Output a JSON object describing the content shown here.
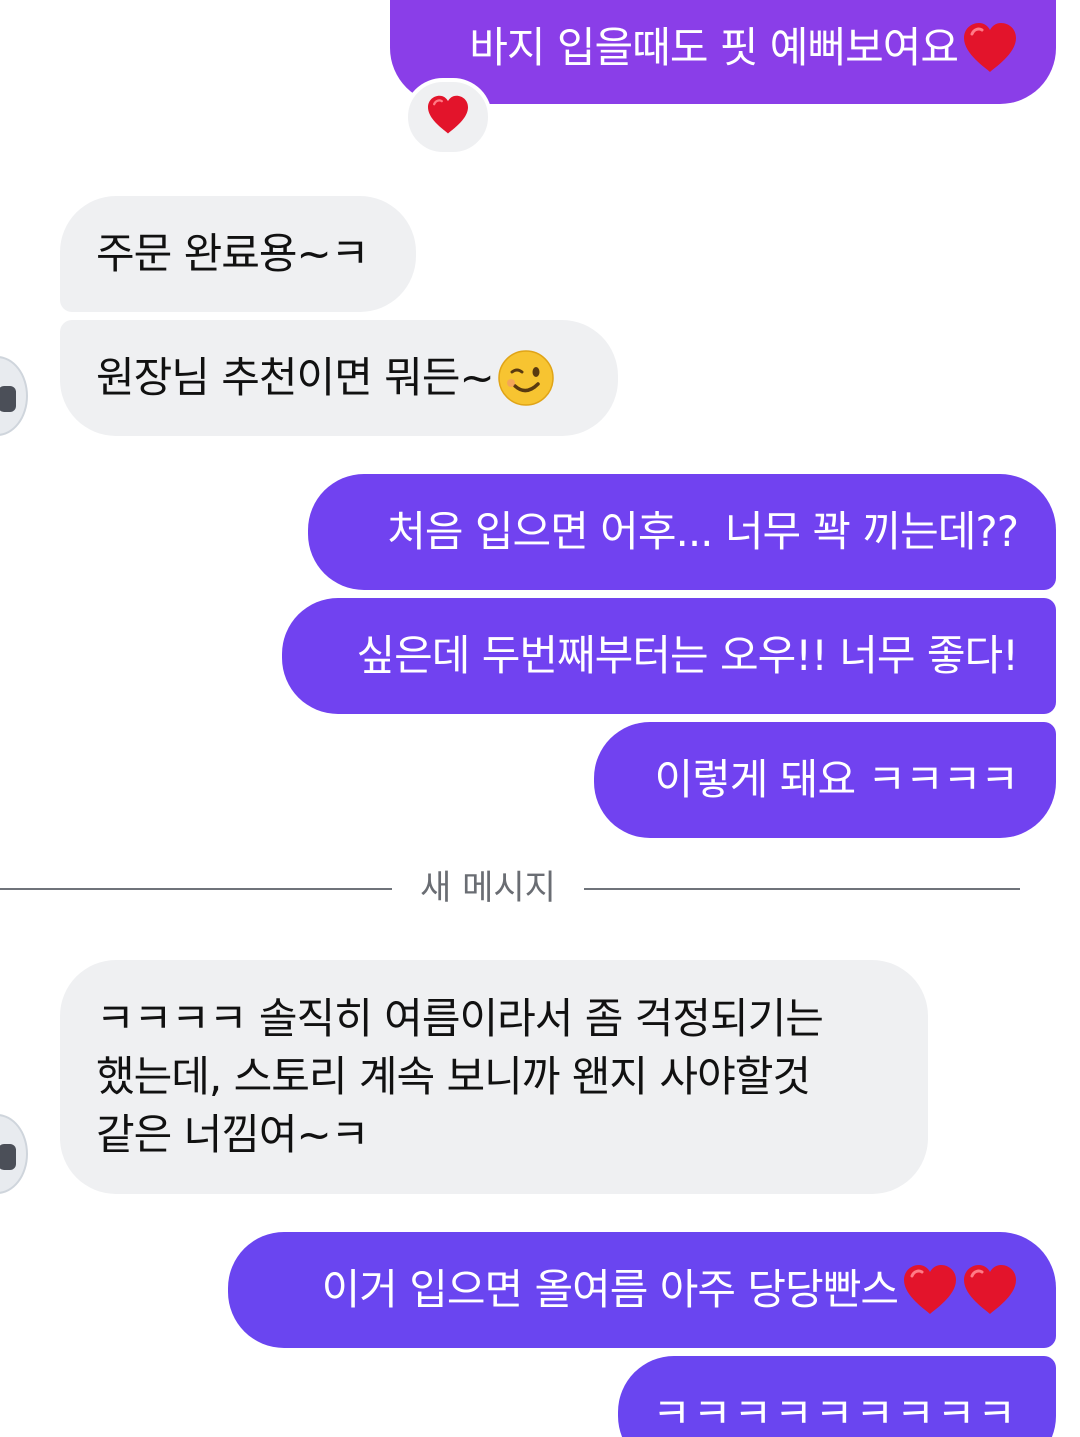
{
  "colors": {
    "outgoing_bubble": "#7142f0",
    "outgoing_bubble_top": "#8a3ee8",
    "incoming_bubble": "#eff0f2",
    "divider": "#6f737a"
  },
  "messages": [
    {
      "id": "m1",
      "direction": "outgoing",
      "text": "바지 입을때도 핏 예뻐보여요",
      "emoji": [
        "red-heart"
      ]
    },
    {
      "id": "m2",
      "direction": "incoming",
      "text": "주문 완료용~ㅋ"
    },
    {
      "id": "m3",
      "direction": "incoming",
      "text": "원장님 추천이면 뭐든~",
      "emoji": [
        "winking-face"
      ]
    },
    {
      "id": "m4",
      "direction": "outgoing",
      "text": "처음 입으면 어후... 너무 꽉 끼는데??"
    },
    {
      "id": "m5",
      "direction": "outgoing",
      "text": "싶은데 두번째부터는 오우!! 너무 좋다!"
    },
    {
      "id": "m6",
      "direction": "outgoing",
      "text": "이렇게 돼요 ㅋㅋㅋㅋ"
    },
    {
      "id": "m7",
      "direction": "incoming",
      "lines": [
        "ㅋㅋㅋㅋ 솔직히 여름이라서 좀 걱정되기는",
        "했는데, 스토리 계속 보니까 왠지 사야할것",
        "같은 너낌여~ㅋ"
      ]
    },
    {
      "id": "m8",
      "direction": "outgoing",
      "text": "이거 입으면 올여름 아주 당당빤스",
      "emoji": [
        "red-heart",
        "red-heart"
      ]
    },
    {
      "id": "m9",
      "direction": "outgoing",
      "text": "ㅋㅋㅋㅋㅋㅋㅋㅋㅋ"
    }
  ],
  "reaction": {
    "emoji": "red-heart",
    "on_message": "m1"
  },
  "divider": {
    "label": "새 메시지"
  }
}
